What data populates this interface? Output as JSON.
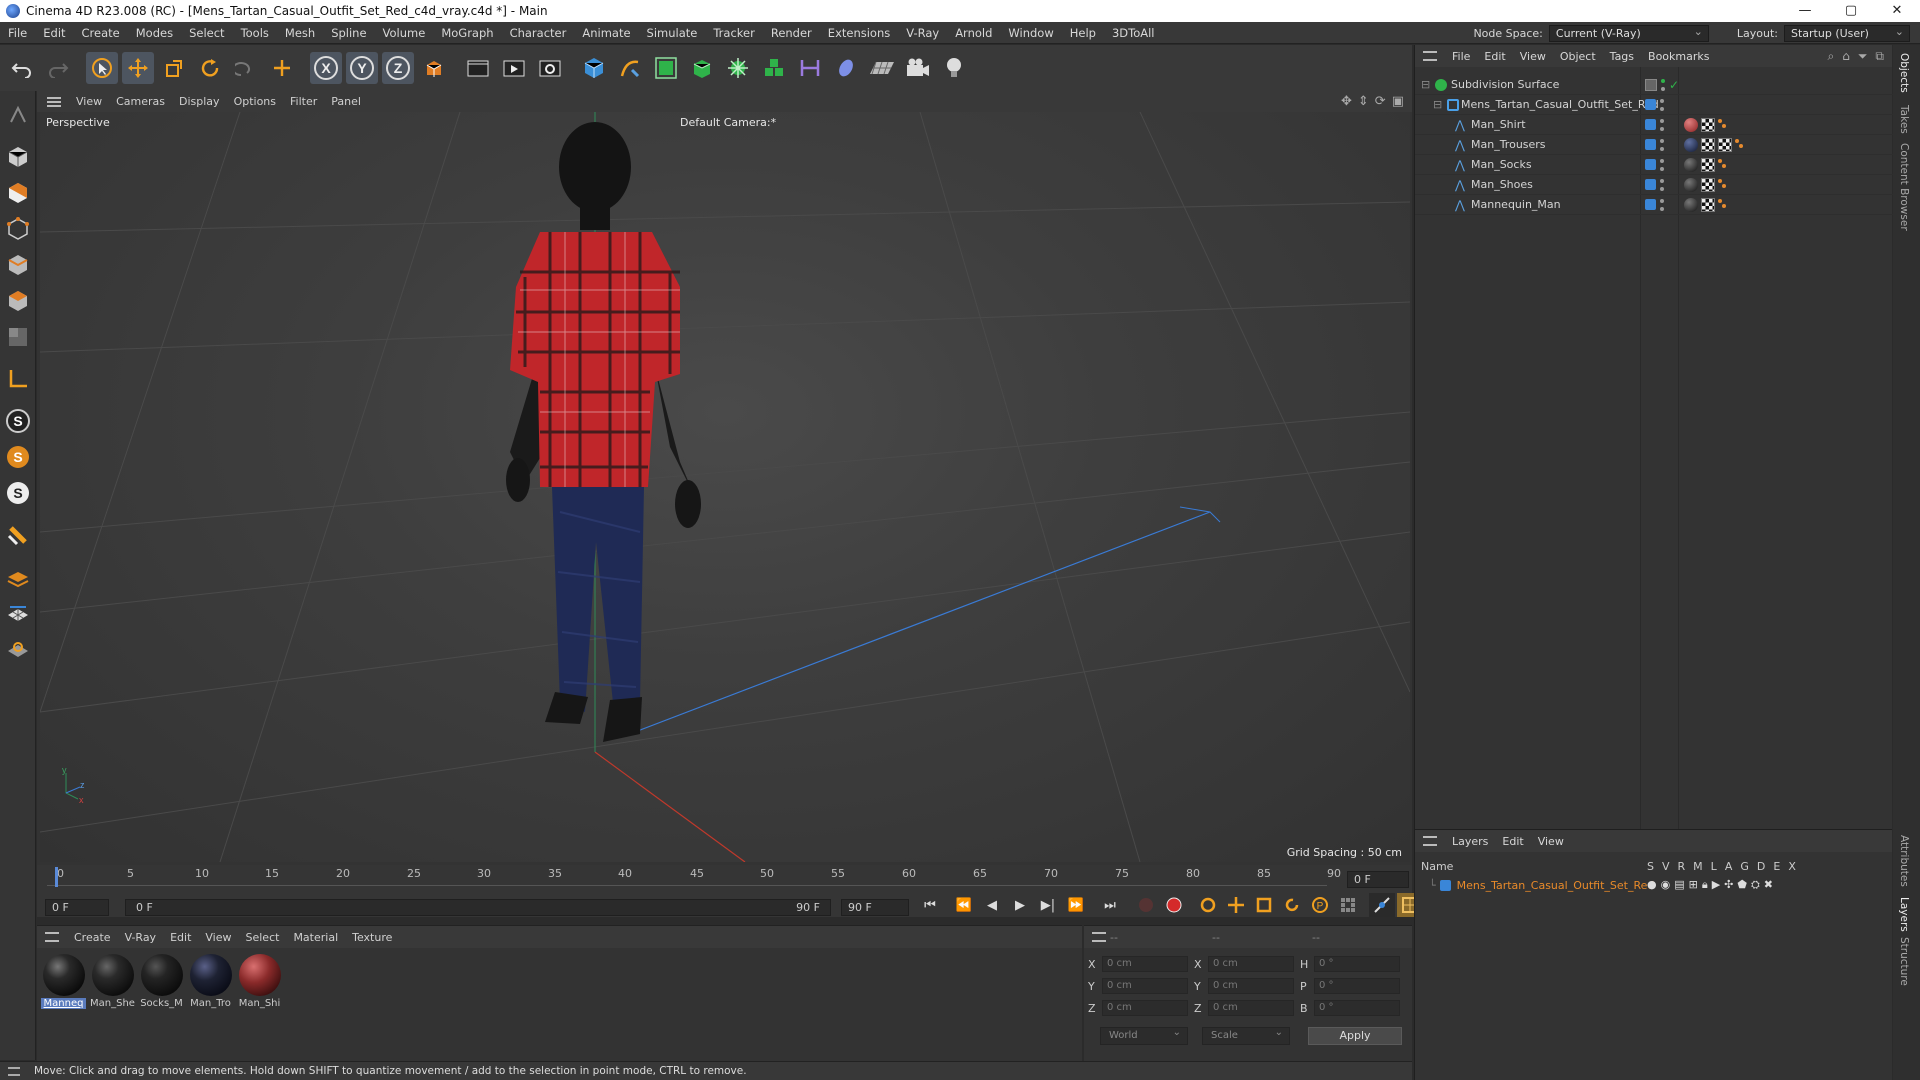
{
  "window": {
    "title": "Cinema 4D R23.008 (RC) - [Mens_Tartan_Casual_Outfit_Set_Red_c4d_vray.c4d *] - Main",
    "controls": [
      "—",
      "▢",
      "✕"
    ]
  },
  "menubar": {
    "items": [
      "File",
      "Edit",
      "Create",
      "Modes",
      "Select",
      "Tools",
      "Mesh",
      "Spline",
      "Volume",
      "MoGraph",
      "Character",
      "Animate",
      "Simulate",
      "Tracker",
      "Render",
      "Extensions",
      "V-Ray",
      "Arnold",
      "Window",
      "Help",
      "3DToAll"
    ],
    "node_space_label": "Node Space:",
    "node_space_value": "Current (V-Ray)",
    "layout_label": "Layout:",
    "layout_value": "Startup (User)"
  },
  "toolbar": {
    "icons": [
      "undo-icon",
      "redo-icon",
      "select-icon",
      "move-icon",
      "scale-icon",
      "rotate-icon",
      "lasso-icon",
      "add-icon",
      "axis-x-icon",
      "axis-y-icon",
      "axis-z-icon",
      "coordinate-system-icon",
      "render-region-icon",
      "render-view-icon",
      "render-settings-icon",
      "cube-icon",
      "pen-icon",
      "subdivision-icon",
      "extrude-icon",
      "mograph-icon",
      "character-icon",
      "measure-icon",
      "deformer-icon",
      "floor-icon",
      "camera-icon",
      "light-icon"
    ],
    "axis_labels": [
      "X",
      "Y",
      "Z"
    ]
  },
  "left_tools": {
    "icons": [
      "make-editable-icon",
      "model-mode-icon",
      "texture-mode-icon",
      "points-mode-icon",
      "edges-mode-icon",
      "polygons-mode-icon",
      "uv-mode-icon",
      "axis-mode-icon",
      "snap-s1-icon",
      "snap-s2-icon",
      "snap-s3-icon",
      "magnet-icon",
      "layers-icon",
      "grid-icon",
      "workplane-icon"
    ],
    "snap_labels": [
      "S",
      "S",
      "S"
    ]
  },
  "viewport": {
    "menu": [
      "View",
      "Cameras",
      "Display",
      "Options",
      "Filter",
      "Panel"
    ],
    "label": "Perspective",
    "camera": "Default Camera",
    "camera_suffix": ":*",
    "grid_spacing": "Grid Spacing : 50 cm",
    "axis_labels": {
      "y": "y",
      "z": "z",
      "x": "x"
    }
  },
  "timeline": {
    "ticks": [
      "0",
      "5",
      "10",
      "15",
      "20",
      "25",
      "30",
      "35",
      "40",
      "45",
      "50",
      "55",
      "60",
      "65",
      "70",
      "75",
      "80",
      "85",
      "90"
    ],
    "current_frame_right": "0 F",
    "start_field": "0 F",
    "range_start": "0 F",
    "range_end": "90 F",
    "end_field": "90 F"
  },
  "materials": {
    "menu": [
      "Create",
      "V-Ray",
      "Edit",
      "View",
      "Select",
      "Material",
      "Texture"
    ],
    "items": [
      {
        "name": "Manneq",
        "color": "#1a1a1a",
        "selected": true
      },
      {
        "name": "Man_She",
        "color": "#202020",
        "selected": false
      },
      {
        "name": "Socks_M",
        "color": "#1c1c1c",
        "selected": false
      },
      {
        "name": "Man_Tro",
        "color": "#1e2233",
        "selected": false
      },
      {
        "name": "Man_Shi",
        "color": "#8a2a2a",
        "selected": false
      }
    ]
  },
  "coords": {
    "headers": [
      "--",
      "--",
      "--"
    ],
    "rows": [
      {
        "a": "X",
        "av": "0 cm",
        "b": "X",
        "bv": "0 cm",
        "c": "H",
        "cv": "0 °"
      },
      {
        "a": "Y",
        "av": "0 cm",
        "b": "Y",
        "bv": "0 cm",
        "c": "P",
        "cv": "0 °"
      },
      {
        "a": "Z",
        "av": "0 cm",
        "b": "Z",
        "bv": "0 cm",
        "c": "B",
        "cv": "0 °"
      }
    ],
    "space": "World",
    "mode": "Scale",
    "apply": "Apply"
  },
  "status": {
    "text": "Move: Click and drag to move elements. Hold down SHIFT to quantize movement / add to the selection in point mode, CTRL to remove."
  },
  "objects": {
    "menu": [
      "File",
      "Edit",
      "View",
      "Object",
      "Tags",
      "Bookmarks"
    ],
    "rows": [
      {
        "name": "Subdivision Surface",
        "level": 0,
        "type": "subdivision"
      },
      {
        "name": "Mens_Tartan_Casual_Outfit_Set_Red",
        "level": 1,
        "type": "null"
      },
      {
        "name": "Man_Shirt",
        "level": 2,
        "type": "mesh",
        "tag": "#b22222"
      },
      {
        "name": "Man_Trousers",
        "level": 2,
        "type": "mesh",
        "tag": "#1e2a4a"
      },
      {
        "name": "Man_Socks",
        "level": 2,
        "type": "mesh",
        "tag": "#1a1a1a"
      },
      {
        "name": "Man_Shoes",
        "level": 2,
        "type": "mesh",
        "tag": "#1a1a1a"
      },
      {
        "name": "Mannequin_Man",
        "level": 2,
        "type": "mesh",
        "tag": "#1a1a1a"
      }
    ]
  },
  "layers": {
    "menu": [
      "Layers",
      "Edit",
      "View"
    ],
    "header_name": "Name",
    "header_flags": [
      "S",
      "V",
      "R",
      "M",
      "L",
      "A",
      "G",
      "D",
      "E",
      "X"
    ],
    "row_name": "Mens_Tartan_Casual_Outfit_Set_Red",
    "row_color": "#3a86d8"
  },
  "side_tabs": [
    "Objects",
    "Takes",
    "Content Browser",
    "Attributes",
    "Layers",
    "Structure"
  ]
}
